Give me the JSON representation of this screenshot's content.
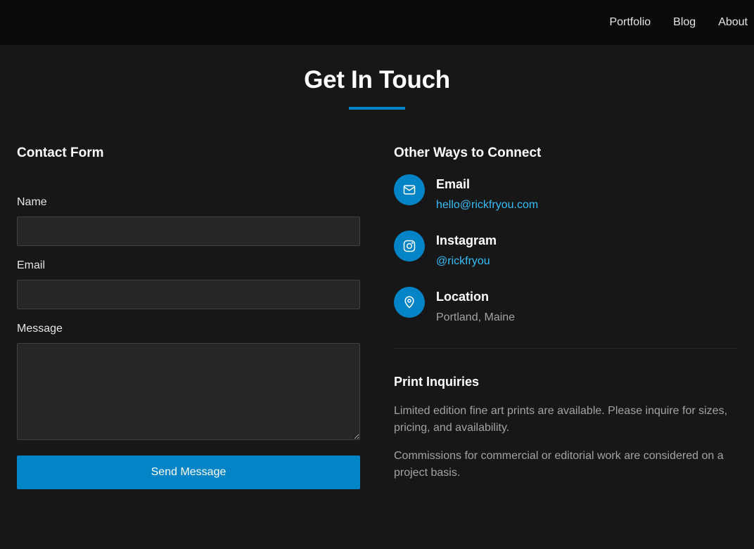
{
  "nav": {
    "items": [
      {
        "label": "Portfolio"
      },
      {
        "label": "Blog"
      },
      {
        "label": "About"
      }
    ]
  },
  "page": {
    "title": "Get In Touch"
  },
  "contact_form": {
    "title": "Contact Form",
    "fields": {
      "name": {
        "label": "Name",
        "value": "",
        "placeholder": ""
      },
      "email": {
        "label": "Email",
        "value": "",
        "placeholder": ""
      },
      "message": {
        "label": "Message",
        "value": "",
        "placeholder": ""
      }
    },
    "submit_label": "Send Message"
  },
  "connect": {
    "title": "Other Ways to Connect",
    "items": [
      {
        "icon": "mail-icon",
        "title": "Email",
        "value": "hello@rickfryou.com"
      },
      {
        "icon": "instagram-icon",
        "title": "Instagram",
        "value": "@rickfryou"
      },
      {
        "icon": "map-pin-icon",
        "title": "Location",
        "value": "Portland, Maine"
      }
    ]
  },
  "print_inquiries": {
    "title": "Print Inquiries",
    "paragraphs": [
      "Limited edition fine art prints are available. Please inquire for sizes, pricing, and availability.",
      "Commissions for commercial or editorial work are considered on a project basis."
    ]
  },
  "colors": {
    "accent": "#0284c7",
    "link": "#38bdf8",
    "background": "#171717",
    "header": "#0a0a0a",
    "input": "#262626"
  }
}
